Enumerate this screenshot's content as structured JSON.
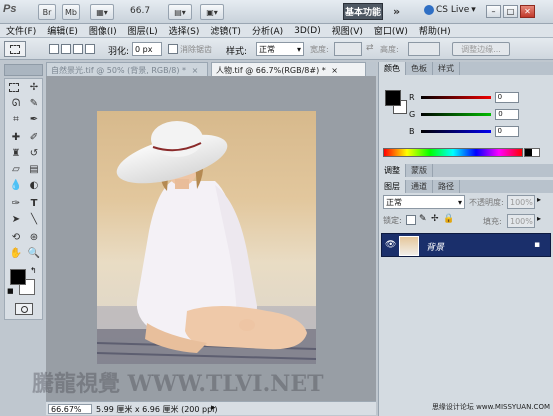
{
  "app": {
    "logo": "Ps",
    "zoom_display": "66.7",
    "workspace_label": "基本功能",
    "cs_live_label": "CS Live"
  },
  "menu": [
    "文件(F)",
    "编辑(E)",
    "图像(I)",
    "图层(L)",
    "选择(S)",
    "滤镜(T)",
    "分析(A)",
    "3D(D)",
    "视图(V)",
    "窗口(W)",
    "帮助(H)"
  ],
  "options": {
    "feather_label": "羽化:",
    "feather_value": "0 px",
    "antialias_label": "消除锯齿",
    "style_label": "样式:",
    "style_value": "正常",
    "width_label": "宽度:",
    "height_label": "高度:",
    "refine_label": "调整边缘..."
  },
  "documents": {
    "tabs": [
      {
        "label": "自然景光.tif @ 50% (背景, RGB/8) *"
      },
      {
        "label": "人物.tif @ 66.7%(RGB/8#) *"
      }
    ]
  },
  "status": {
    "zoom": "66.67%",
    "doc_info": "5.99 厘米 x 6.96 厘米 (200 ppi)"
  },
  "watermark": "騰龍視覺 WWW.TLVI.NET",
  "site_credit": "思缘设计论坛 www.MISSYUAN.COM",
  "color_panel": {
    "tabs": [
      "颜色",
      "色板",
      "样式"
    ],
    "channels": [
      {
        "label": "R",
        "value": "0",
        "color": "#cc0000"
      },
      {
        "label": "G",
        "value": "0",
        "color": "#00aa00"
      },
      {
        "label": "B",
        "value": "0",
        "color": "#0000cc"
      }
    ]
  },
  "adjust_panel": {
    "tabs": [
      "调整",
      "蒙版"
    ]
  },
  "layers_panel": {
    "tabs": [
      "图层",
      "通道",
      "路径"
    ],
    "blend_mode": "正常",
    "opacity_label": "不透明度:",
    "opacity_value": "100%",
    "lock_label": "锁定:",
    "fill_label": "填充:",
    "fill_value": "100%",
    "layers": [
      {
        "name": "背景"
      }
    ]
  },
  "colors": {
    "foreground": "#000000",
    "background": "#ffffff",
    "accent": "#1a2f6b"
  }
}
